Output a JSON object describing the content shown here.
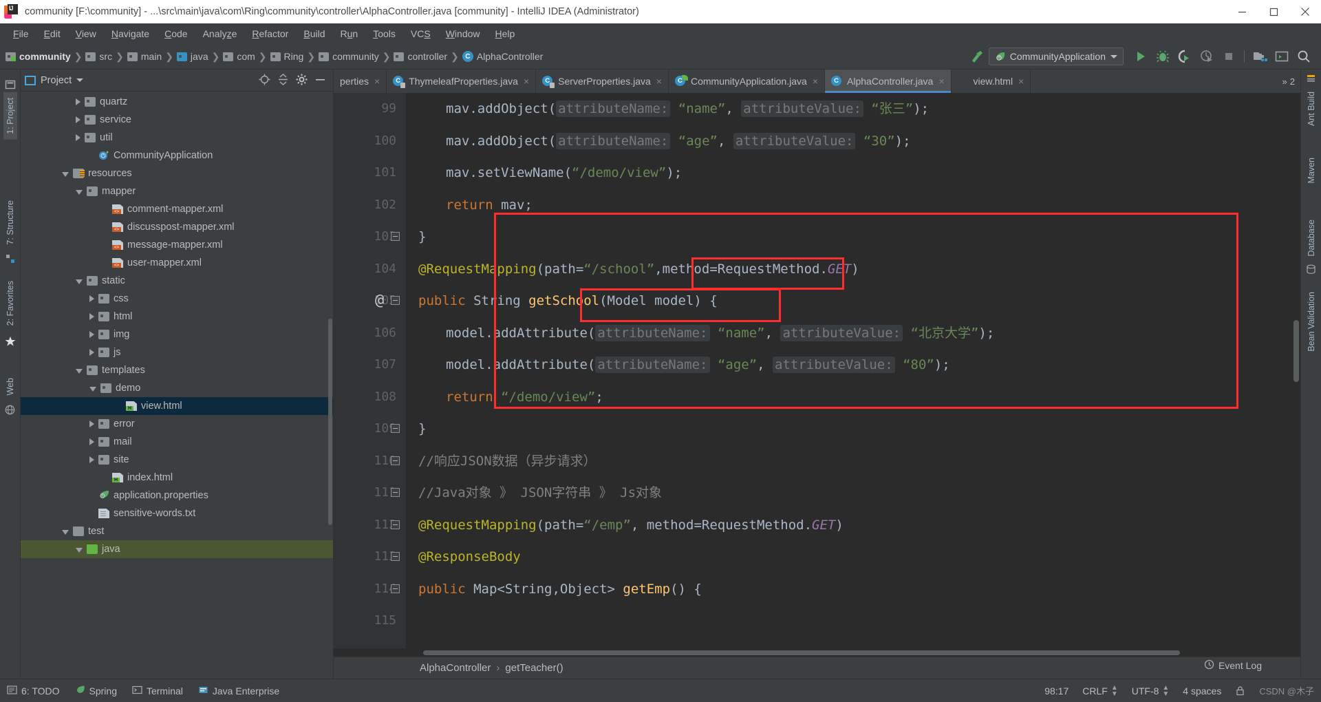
{
  "window": {
    "title": "community [F:\\community] - ...\\src\\main\\java\\com\\Ring\\community\\controller\\AlphaController.java [community] - IntelliJ IDEA (Administrator)",
    "app_icon": "intellij-idea-icon",
    "minimize_label": "Minimize",
    "maximize_label": "Maximize",
    "close_label": "Close"
  },
  "menubar": {
    "items": [
      {
        "label": "File",
        "mnemonic": "F"
      },
      {
        "label": "Edit",
        "mnemonic": "E"
      },
      {
        "label": "View",
        "mnemonic": "V"
      },
      {
        "label": "Navigate",
        "mnemonic": "N"
      },
      {
        "label": "Code",
        "mnemonic": "C"
      },
      {
        "label": "Analyze",
        "mnemonic": "z"
      },
      {
        "label": "Refactor",
        "mnemonic": "R"
      },
      {
        "label": "Build",
        "mnemonic": "B"
      },
      {
        "label": "Run",
        "mnemonic": "u"
      },
      {
        "label": "Tools",
        "mnemonic": "T"
      },
      {
        "label": "VCS",
        "mnemonic": "S"
      },
      {
        "label": "Window",
        "mnemonic": "W"
      },
      {
        "label": "Help",
        "mnemonic": "H"
      }
    ]
  },
  "breadcrumbs": {
    "items": [
      {
        "label": "community",
        "icon": "module-folder-icon",
        "bold": true
      },
      {
        "label": "src",
        "icon": "folder-icon"
      },
      {
        "label": "main",
        "icon": "folder-icon"
      },
      {
        "label": "java",
        "icon": "source-root-folder-icon"
      },
      {
        "label": "com",
        "icon": "package-folder-icon"
      },
      {
        "label": "Ring",
        "icon": "package-folder-icon"
      },
      {
        "label": "community",
        "icon": "package-folder-icon"
      },
      {
        "label": "controller",
        "icon": "package-folder-icon"
      },
      {
        "label": "AlphaController",
        "icon": "java-class-icon"
      }
    ]
  },
  "toolbar": {
    "hammer_icon": "build-hammer-icon",
    "run_config": "CommunityApplication",
    "run_config_icon": "spring-boot-icon",
    "buttons": [
      {
        "name": "run-button",
        "icon": "play-icon",
        "color": "#59a869"
      },
      {
        "name": "debug-button",
        "icon": "bug-icon",
        "color": "#59a869"
      },
      {
        "name": "run-with-coverage-button",
        "icon": "coverage-icon",
        "color": "#59a869"
      },
      {
        "name": "profile-button",
        "icon": "profiler-icon",
        "color": "#8b8f91"
      },
      {
        "name": "stop-button",
        "icon": "stop-square-icon",
        "color": "#7a7d7e"
      },
      {
        "name": "project-structure-button",
        "icon": "project-structure-icon",
        "color": "#a9b7c6"
      },
      {
        "name": "terminal-button",
        "icon": "terminal-icon",
        "color": "#a9b7c6"
      },
      {
        "name": "search-everywhere-button",
        "icon": "search-icon",
        "color": "#a9b7c6"
      }
    ]
  },
  "left_tool_window_bar": {
    "tabs": [
      {
        "label": "1: Project",
        "active": true,
        "name": "tool-tab-project"
      },
      {
        "label": "7: Structure",
        "active": false,
        "name": "tool-tab-structure"
      },
      {
        "label": "2: Favorites",
        "active": false,
        "name": "tool-tab-favorites"
      },
      {
        "label": "Web",
        "active": false,
        "name": "tool-tab-web"
      }
    ],
    "icons": [
      "project-files-icon",
      "structure-icon",
      "favorites-star-icon",
      "web-globe-icon"
    ]
  },
  "right_tool_window_bar": {
    "tabs": [
      {
        "label": "Ant Build",
        "name": "tool-tab-ant-build"
      },
      {
        "label": "Maven",
        "name": "tool-tab-maven"
      },
      {
        "label": "Database",
        "name": "tool-tab-database"
      },
      {
        "label": "Bean Validation",
        "name": "tool-tab-bean-validation"
      }
    ]
  },
  "project_panel": {
    "title": "Project",
    "actions": [
      "locate-target-icon",
      "collapse-all-icon",
      "settings-gear-icon",
      "hide-minimize-icon"
    ],
    "tree": [
      {
        "label": "quartz",
        "indent": 4,
        "arrow": "closed",
        "icon": "folder",
        "sel": false
      },
      {
        "label": "service",
        "indent": 4,
        "arrow": "closed",
        "icon": "folder",
        "sel": false
      },
      {
        "label": "util",
        "indent": 4,
        "arrow": "closed",
        "icon": "folder",
        "sel": false
      },
      {
        "label": "CommunityApplication",
        "indent": 5,
        "arrow": "none",
        "icon": "springcls",
        "sel": false
      },
      {
        "label": "resources",
        "indent": 3,
        "arrow": "open",
        "icon": "res",
        "sel": false
      },
      {
        "label": "mapper",
        "indent": 4,
        "arrow": "open",
        "icon": "folder",
        "sel": false
      },
      {
        "label": "comment-mapper.xml",
        "indent": 6,
        "arrow": "none",
        "icon": "xml",
        "sel": false
      },
      {
        "label": "discusspost-mapper.xml",
        "indent": 6,
        "arrow": "none",
        "icon": "xml",
        "sel": false
      },
      {
        "label": "message-mapper.xml",
        "indent": 6,
        "arrow": "none",
        "icon": "xml",
        "sel": false
      },
      {
        "label": "user-mapper.xml",
        "indent": 6,
        "arrow": "none",
        "icon": "xml",
        "sel": false
      },
      {
        "label": "static",
        "indent": 4,
        "arrow": "open",
        "icon": "folder",
        "sel": false
      },
      {
        "label": "css",
        "indent": 5,
        "arrow": "closed",
        "icon": "folder",
        "sel": false
      },
      {
        "label": "html",
        "indent": 5,
        "arrow": "closed",
        "icon": "folder",
        "sel": false
      },
      {
        "label": "img",
        "indent": 5,
        "arrow": "closed",
        "icon": "folder",
        "sel": false
      },
      {
        "label": "js",
        "indent": 5,
        "arrow": "closed",
        "icon": "folder",
        "sel": false
      },
      {
        "label": "templates",
        "indent": 4,
        "arrow": "open",
        "icon": "folder",
        "sel": false
      },
      {
        "label": "demo",
        "indent": 5,
        "arrow": "open",
        "icon": "folder",
        "sel": false
      },
      {
        "label": "view.html",
        "indent": 7,
        "arrow": "none",
        "icon": "html",
        "sel": true
      },
      {
        "label": "error",
        "indent": 5,
        "arrow": "closed",
        "icon": "folder",
        "sel": false
      },
      {
        "label": "mail",
        "indent": 5,
        "arrow": "closed",
        "icon": "folder",
        "sel": false
      },
      {
        "label": "site",
        "indent": 5,
        "arrow": "closed",
        "icon": "folder",
        "sel": false
      },
      {
        "label": "index.html",
        "indent": 6,
        "arrow": "none",
        "icon": "html",
        "sel": false
      },
      {
        "label": "application.properties",
        "indent": 5,
        "arrow": "none",
        "icon": "spring",
        "sel": false
      },
      {
        "label": "sensitive-words.txt",
        "indent": 5,
        "arrow": "none",
        "icon": "txt",
        "sel": false
      },
      {
        "label": "test",
        "indent": 3,
        "arrow": "open",
        "icon": "folderplain",
        "sel": false
      },
      {
        "label": "java",
        "indent": 4,
        "arrow": "open",
        "icon": "folderGreen",
        "sel": false,
        "sel2": true
      }
    ]
  },
  "editor": {
    "tabs": [
      {
        "label": "perties",
        "icon": "properties-icon",
        "active": false,
        "truncated": true
      },
      {
        "label": "ThymeleafProperties.java",
        "icon": "java-class-lock-icon",
        "active": false
      },
      {
        "label": "ServerProperties.java",
        "icon": "java-class-lock-icon",
        "active": false
      },
      {
        "label": "CommunityApplication.java",
        "icon": "spring-class-icon",
        "active": false
      },
      {
        "label": "AlphaController.java",
        "icon": "java-class-icon",
        "active": true
      },
      {
        "label": "view.html",
        "icon": "html-file-icon",
        "active": false
      }
    ],
    "tabs_overflow": "2",
    "breadcrumb": {
      "class": "AlphaController",
      "method": "getTeacher()",
      "separator": "›"
    },
    "gutter_marker_at_line": "105",
    "gutter_marker_glyph": "@",
    "lines": [
      {
        "num": "99",
        "fold": false,
        "indent": 1,
        "tokens": [
          {
            "t": "mav.addObject(",
            "c": "plain"
          },
          {
            "t": "attributeName:",
            "c": "hint"
          },
          {
            "t": " ",
            "c": "plain"
          },
          {
            "t": "“name”",
            "c": "str"
          },
          {
            "t": ", ",
            "c": "plain"
          },
          {
            "t": "attributeValue:",
            "c": "hint"
          },
          {
            "t": " ",
            "c": "plain"
          },
          {
            "t": "“张三”",
            "c": "str"
          },
          {
            "t": ");",
            "c": "plain"
          }
        ]
      },
      {
        "num": "100",
        "fold": false,
        "indent": 1,
        "tokens": [
          {
            "t": "mav.addObject(",
            "c": "plain"
          },
          {
            "t": "attributeName:",
            "c": "hint"
          },
          {
            "t": " ",
            "c": "plain"
          },
          {
            "t": "“age”",
            "c": "str"
          },
          {
            "t": ", ",
            "c": "plain"
          },
          {
            "t": "attributeValue:",
            "c": "hint"
          },
          {
            "t": " ",
            "c": "plain"
          },
          {
            "t": "“30”",
            "c": "str"
          },
          {
            "t": ");",
            "c": "plain"
          }
        ]
      },
      {
        "num": "101",
        "fold": false,
        "indent": 1,
        "tokens": [
          {
            "t": "mav.setViewName(",
            "c": "plain"
          },
          {
            "t": "“/demo/view”",
            "c": "str"
          },
          {
            "t": ");",
            "c": "plain"
          }
        ]
      },
      {
        "num": "102",
        "fold": false,
        "indent": 1,
        "tokens": [
          {
            "t": "return",
            "c": "kw"
          },
          {
            "t": " mav;",
            "c": "plain"
          }
        ]
      },
      {
        "num": "103",
        "fold": true,
        "indent": 0,
        "tokens": [
          {
            "t": "}",
            "c": "plain"
          }
        ]
      },
      {
        "num": "104",
        "fold": false,
        "indent": 0,
        "tokens": [
          {
            "t": "@RequestMapping",
            "c": "anno"
          },
          {
            "t": "(",
            "c": "plain"
          },
          {
            "t": "path",
            "c": "plain"
          },
          {
            "t": "=",
            "c": "plain"
          },
          {
            "t": "“/school”",
            "c": "str"
          },
          {
            "t": ",",
            "c": "plain"
          },
          {
            "t": "method",
            "c": "plain"
          },
          {
            "t": "=RequestMethod.",
            "c": "plain"
          },
          {
            "t": "GET",
            "c": "fld"
          },
          {
            "t": ")",
            "c": "plain"
          }
        ]
      },
      {
        "num": "105",
        "fold": true,
        "indent": 0,
        "tokens": [
          {
            "t": "public",
            "c": "kw"
          },
          {
            "t": " String ",
            "c": "plain"
          },
          {
            "t": "getSchool",
            "c": "mth"
          },
          {
            "t": "(Model model) {",
            "c": "plain"
          }
        ]
      },
      {
        "num": "106",
        "fold": false,
        "indent": 1,
        "tokens": [
          {
            "t": "model.addAttribute(",
            "c": "plain"
          },
          {
            "t": "attributeName:",
            "c": "hint"
          },
          {
            "t": " ",
            "c": "plain"
          },
          {
            "t": "“name”",
            "c": "str"
          },
          {
            "t": ", ",
            "c": "plain"
          },
          {
            "t": "attributeValue:",
            "c": "hint"
          },
          {
            "t": " ",
            "c": "plain"
          },
          {
            "t": "“北京大学”",
            "c": "str"
          },
          {
            "t": ");",
            "c": "plain"
          }
        ]
      },
      {
        "num": "107",
        "fold": false,
        "indent": 1,
        "tokens": [
          {
            "t": "model.addAttribute(",
            "c": "plain"
          },
          {
            "t": "attributeName:",
            "c": "hint"
          },
          {
            "t": " ",
            "c": "plain"
          },
          {
            "t": "“age”",
            "c": "str"
          },
          {
            "t": ", ",
            "c": "plain"
          },
          {
            "t": "attributeValue:",
            "c": "hint"
          },
          {
            "t": " ",
            "c": "plain"
          },
          {
            "t": "“80”",
            "c": "str"
          },
          {
            "t": ");",
            "c": "plain"
          }
        ]
      },
      {
        "num": "108",
        "fold": false,
        "indent": 1,
        "tokens": [
          {
            "t": "return",
            "c": "kw"
          },
          {
            "t": " ",
            "c": "plain"
          },
          {
            "t": "“/demo/view”",
            "c": "str"
          },
          {
            "t": ";",
            "c": "plain"
          }
        ]
      },
      {
        "num": "109",
        "fold": true,
        "indent": 0,
        "tokens": [
          {
            "t": "}",
            "c": "plain"
          }
        ]
      },
      {
        "num": "110",
        "fold": true,
        "indent": 0,
        "tokens": [
          {
            "t": "//响应JSON数据（异步请求）",
            "c": "cmt"
          }
        ]
      },
      {
        "num": "111",
        "fold": true,
        "indent": 0,
        "tokens": [
          {
            "t": "//Java对象 》 JSON字符串 》 Js对象",
            "c": "cmt"
          }
        ]
      },
      {
        "num": "112",
        "fold": true,
        "indent": 0,
        "tokens": [
          {
            "t": "@RequestMapping",
            "c": "anno"
          },
          {
            "t": "(",
            "c": "plain"
          },
          {
            "t": "path",
            "c": "plain"
          },
          {
            "t": "=",
            "c": "plain"
          },
          {
            "t": "“/emp”",
            "c": "str"
          },
          {
            "t": ", ",
            "c": "plain"
          },
          {
            "t": "method",
            "c": "plain"
          },
          {
            "t": "=RequestMethod.",
            "c": "plain"
          },
          {
            "t": "GET",
            "c": "fld"
          },
          {
            "t": ")",
            "c": "plain"
          }
        ]
      },
      {
        "num": "113",
        "fold": true,
        "indent": 0,
        "tokens": [
          {
            "t": "@ResponseBody",
            "c": "anno"
          }
        ]
      },
      {
        "num": "114",
        "fold": true,
        "indent": 0,
        "tokens": [
          {
            "t": "public",
            "c": "kw"
          },
          {
            "t": " Map<String,Object> ",
            "c": "plain"
          },
          {
            "t": "getEmp",
            "c": "mth"
          },
          {
            "t": "() {",
            "c": "plain"
          }
        ]
      },
      {
        "num": "115",
        "fold": false,
        "indent": 0,
        "tokens": []
      }
    ],
    "annotations": {
      "highlight_color": "#ff2d2d",
      "boxes": [
        {
          "name": "method-body-highlight"
        },
        {
          "name": "model-parameter-highlight"
        },
        {
          "name": "add-attribute-call-highlight"
        }
      ]
    }
  },
  "statusbar": {
    "left": [
      {
        "label": "6: TODO",
        "icon": "todo-icon",
        "mnemonic": "6"
      },
      {
        "label": "Spring",
        "icon": "spring-leaf-icon"
      },
      {
        "label": "Terminal",
        "icon": "terminal-icon"
      },
      {
        "label": "Java Enterprise",
        "icon": "java-enterprise-icon"
      }
    ],
    "right": {
      "caret_position": "98:17",
      "line_separator": "CRLF",
      "encoding": "UTF-8",
      "indent": "4 spaces",
      "event_log": "Event Log",
      "event_log_icon": "event-log-icon",
      "watermark": "CSDN @木子"
    }
  }
}
